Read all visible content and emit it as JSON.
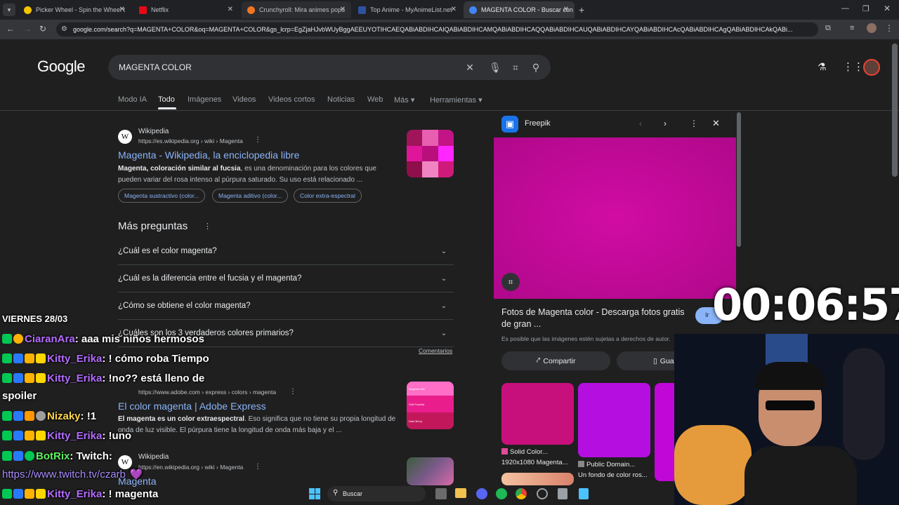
{
  "browser": {
    "tabs": [
      {
        "label": "Picker Wheel - Spin the Wheel t",
        "color": "#f5c400"
      },
      {
        "label": "Netflix",
        "color": "#e50914"
      },
      {
        "label": "Crunchyroll: Mira animes popu",
        "color": "#f47521"
      },
      {
        "label": "Top Anime - MyAnimeList.net",
        "color": "#2e51a2"
      },
      {
        "label": "MAGENTA COLOR - Buscar con",
        "color": "#4285f4"
      }
    ],
    "new_tab": "+",
    "url": "google.com/search?q=MAGENTA+COLOR&oq=MAGENTA+COLOR&gs_lcrp=EgZjaHJvbWUyBggAEEUYOTIHCAEQABiABDIHCAIQABiABDIHCAMQABiABDIHCAQQABiABDIHCAUQABiABDIHCAYQABiABDIHCAcQABiABDIHCAgQABiABDIHCAkQABi..."
  },
  "google": {
    "logo": "Google",
    "query": "MAGENTA COLOR",
    "nav": [
      "Modo IA",
      "Todo",
      "Imágenes",
      "Videos",
      "Videos cortos",
      "Noticias",
      "Web",
      "Más ▾",
      "Herramientas ▾"
    ]
  },
  "results": {
    "r1": {
      "source": "Wikipedia",
      "url": "https://es.wikipedia.org › wiki › Magenta",
      "title": "Magenta - Wikipedia, la enciclopedia libre",
      "snippet_a": "Magenta, ",
      "snippet_b": "coloración similar al fucsia",
      "snippet_c": ", es una denominación para los colores que pueden variar del rosa intenso al púrpura saturado. Su uso está relacionado ...",
      "chips": [
        "Magenta sustractivo (color...",
        "Magenta aditivo (color...",
        "Color extra-espectral"
      ]
    },
    "paa": {
      "heading": "Más preguntas",
      "questions": [
        "¿Cuál es el color magenta?",
        "¿Cuál es la diferencia entre el fucsia y el magenta?",
        "¿Cómo se obtiene el color magenta?",
        "¿Cuáles son los 3 verdaderos colores primarios?"
      ],
      "feedback": "Comentarios"
    },
    "r2": {
      "url": "https://www.adobe.com › express › colors › magenta",
      "title": "El color magenta | Adobe Express",
      "snippet_a": "El magenta es un color extraespectral",
      "snippet_b": ". Eso significa que no tiene su propia longitud de onda de luz visible. El púrpura tiene la longitud de onda más baja y el ...",
      "thumb_labels": [
        "Magenta Mix",
        "Soft Fuschia",
        "Dark Berry"
      ]
    },
    "r3": {
      "source": "Wikipedia",
      "url": "https://en.wikipedia.org › wiki › Magenta",
      "title": "Magenta"
    }
  },
  "panel": {
    "source": "Freepik",
    "title": "Fotos de Magenta color - Descarga fotos gratis de gran ...",
    "rights": "Es posible que las imágenes estén sujetas a derechos de autor.",
    "share": "Compartir",
    "save": "Guardar",
    "visit": "Ir",
    "related": [
      {
        "title": "Solid Color...",
        "meta": "1920x1080 Magenta..."
      },
      {
        "title": "Public Domain...",
        "meta": "Un fondo de color ros..."
      }
    ]
  },
  "stream": {
    "timer": "00:06:57",
    "chat": [
      {
        "user": "",
        "msg": "VIERNES 28/03",
        "ucolor": "#ffffff"
      },
      {
        "user": "CiaranAra",
        "msg": ": aaa mis niños hermosos",
        "ucolor": "#b36bff"
      },
      {
        "user": "Kitty_Erika",
        "msg": ": ! cómo roba Tiempo",
        "ucolor": "#b36bff"
      },
      {
        "user": "Kitty_Erika",
        "msg": ": !no?? está lleno de",
        "ucolor": "#b36bff"
      },
      {
        "user": "",
        "msg": "spoiler",
        "ucolor": "#ffffff"
      },
      {
        "user": "Nizaky",
        "msg": ": !1",
        "ucolor": "#ffd54a"
      },
      {
        "user": "Kitty_Erika",
        "msg": ": !uno",
        "ucolor": "#b36bff"
      },
      {
        "user": "BotRix",
        "msg": ": Twitch:",
        "ucolor": "#5ef05e"
      },
      {
        "user": "",
        "msg": "https://www.twitch.tv/czarb",
        "ucolor": "#a78bfa"
      },
      {
        "user": "Kitty_Erika",
        "msg": ": ! magenta",
        "ucolor": "#b36bff"
      }
    ]
  },
  "taskbar": {
    "search": "Buscar"
  }
}
